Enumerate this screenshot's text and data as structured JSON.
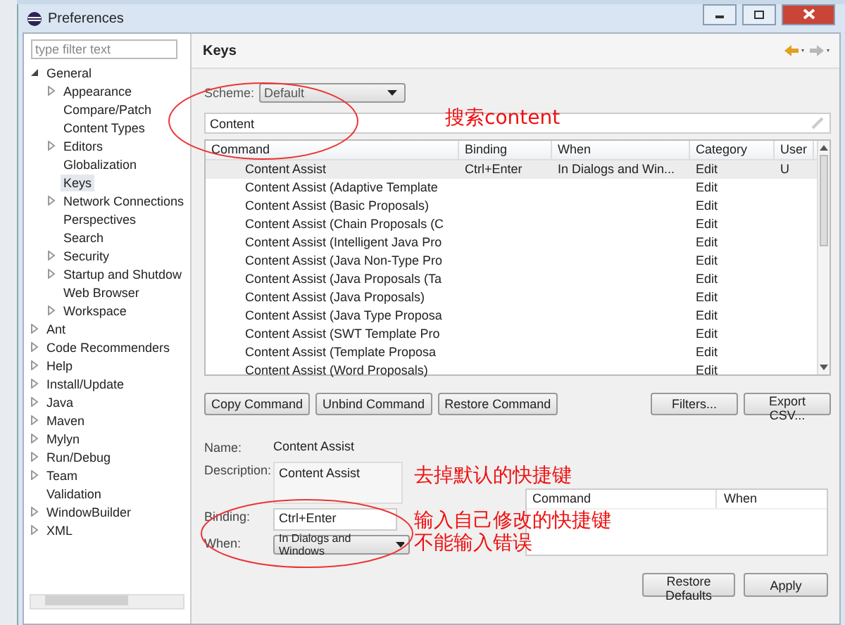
{
  "window": {
    "title": "Preferences"
  },
  "sidebar": {
    "filter_placeholder": "type filter text",
    "tree": [
      {
        "label": "General",
        "kind": "folder",
        "expanded": true,
        "selected": false,
        "children": [
          {
            "label": "Appearance",
            "kind": "folder",
            "expanded": false,
            "selected": false
          },
          {
            "label": "Compare/Patch",
            "kind": "leaf",
            "selected": false
          },
          {
            "label": "Content Types",
            "kind": "leaf",
            "selected": false
          },
          {
            "label": "Editors",
            "kind": "folder",
            "expanded": false,
            "selected": false
          },
          {
            "label": "Globalization",
            "kind": "leaf",
            "selected": false
          },
          {
            "label": "Keys",
            "kind": "leaf",
            "selected": true
          },
          {
            "label": "Network Connections",
            "kind": "folder",
            "expanded": false,
            "selected": false
          },
          {
            "label": "Perspectives",
            "kind": "leaf",
            "selected": false
          },
          {
            "label": "Search",
            "kind": "leaf",
            "selected": false
          },
          {
            "label": "Security",
            "kind": "folder",
            "expanded": false,
            "selected": false
          },
          {
            "label": "Startup and Shutdow",
            "kind": "folder",
            "expanded": false,
            "selected": false
          },
          {
            "label": "Web Browser",
            "kind": "leaf",
            "selected": false
          },
          {
            "label": "Workspace",
            "kind": "folder",
            "expanded": false,
            "selected": false
          }
        ]
      },
      {
        "label": "Ant",
        "kind": "folder",
        "expanded": false,
        "selected": false
      },
      {
        "label": "Code Recommenders",
        "kind": "folder",
        "expanded": false,
        "selected": false
      },
      {
        "label": "Help",
        "kind": "folder",
        "expanded": false,
        "selected": false
      },
      {
        "label": "Install/Update",
        "kind": "folder",
        "expanded": false,
        "selected": false
      },
      {
        "label": "Java",
        "kind": "folder",
        "expanded": false,
        "selected": false
      },
      {
        "label": "Maven",
        "kind": "folder",
        "expanded": false,
        "selected": false
      },
      {
        "label": "Mylyn",
        "kind": "folder",
        "expanded": false,
        "selected": false
      },
      {
        "label": "Run/Debug",
        "kind": "folder",
        "expanded": false,
        "selected": false
      },
      {
        "label": "Team",
        "kind": "folder",
        "expanded": false,
        "selected": false
      },
      {
        "label": "Validation",
        "kind": "leaf",
        "selected": false
      },
      {
        "label": "WindowBuilder",
        "kind": "folder",
        "expanded": false,
        "selected": false
      },
      {
        "label": "XML",
        "kind": "folder",
        "expanded": false,
        "selected": false
      }
    ]
  },
  "page": {
    "title": "Keys",
    "scheme_label": "Scheme:",
    "scheme_value": "Default",
    "filter_value": "Content",
    "table": {
      "columns": [
        "Command",
        "Binding",
        "When",
        "Category",
        "User"
      ],
      "rows": [
        {
          "cells": [
            "Content Assist",
            "Ctrl+Enter",
            "In Dialogs and Win...",
            "Edit",
            "U"
          ],
          "selected": true
        },
        {
          "cells": [
            "Content Assist (Adaptive Template",
            "",
            "",
            "Edit",
            ""
          ],
          "selected": false
        },
        {
          "cells": [
            "Content Assist (Basic Proposals)",
            "",
            "",
            "Edit",
            ""
          ],
          "selected": false
        },
        {
          "cells": [
            "Content Assist (Chain Proposals (C",
            "",
            "",
            "Edit",
            ""
          ],
          "selected": false
        },
        {
          "cells": [
            "Content Assist (Intelligent Java Pro",
            "",
            "",
            "Edit",
            ""
          ],
          "selected": false
        },
        {
          "cells": [
            "Content Assist (Java Non-Type Pro",
            "",
            "",
            "Edit",
            ""
          ],
          "selected": false
        },
        {
          "cells": [
            "Content Assist (Java Proposals (Ta",
            "",
            "",
            "Edit",
            ""
          ],
          "selected": false
        },
        {
          "cells": [
            "Content Assist (Java Proposals)",
            "",
            "",
            "Edit",
            ""
          ],
          "selected": false
        },
        {
          "cells": [
            "Content Assist (Java Type Proposa",
            "",
            "",
            "Edit",
            ""
          ],
          "selected": false
        },
        {
          "cells": [
            "Content Assist (SWT Template Pro",
            "",
            "",
            "Edit",
            ""
          ],
          "selected": false
        },
        {
          "cells": [
            "Content Assist (Template Proposa",
            "",
            "",
            "Edit",
            ""
          ],
          "selected": false
        },
        {
          "cells": [
            "Content Assist (Word Proposals)",
            "",
            "",
            "Edit",
            ""
          ],
          "selected": false
        }
      ]
    },
    "left_buttons": [
      "Copy Command",
      "Unbind Command",
      "Restore Command"
    ],
    "right_buttons": [
      "Filters...",
      "Export CSV..."
    ],
    "name_label": "Name:",
    "name_value": "Content Assist",
    "description_label": "Description:",
    "description_value": "Content Assist",
    "binding_label": "Binding:",
    "binding_value": "Ctrl+Enter",
    "when_label": "When:",
    "when_value": "In Dialogs and Windows",
    "conflicts_columns": [
      "Command",
      "When"
    ],
    "bottom_buttons": [
      "Restore Defaults",
      "Apply"
    ]
  },
  "annotations": [
    "搜索content",
    "去掉默认的快捷键",
    "输入自己修改的快捷键",
    "不能输入错误"
  ]
}
